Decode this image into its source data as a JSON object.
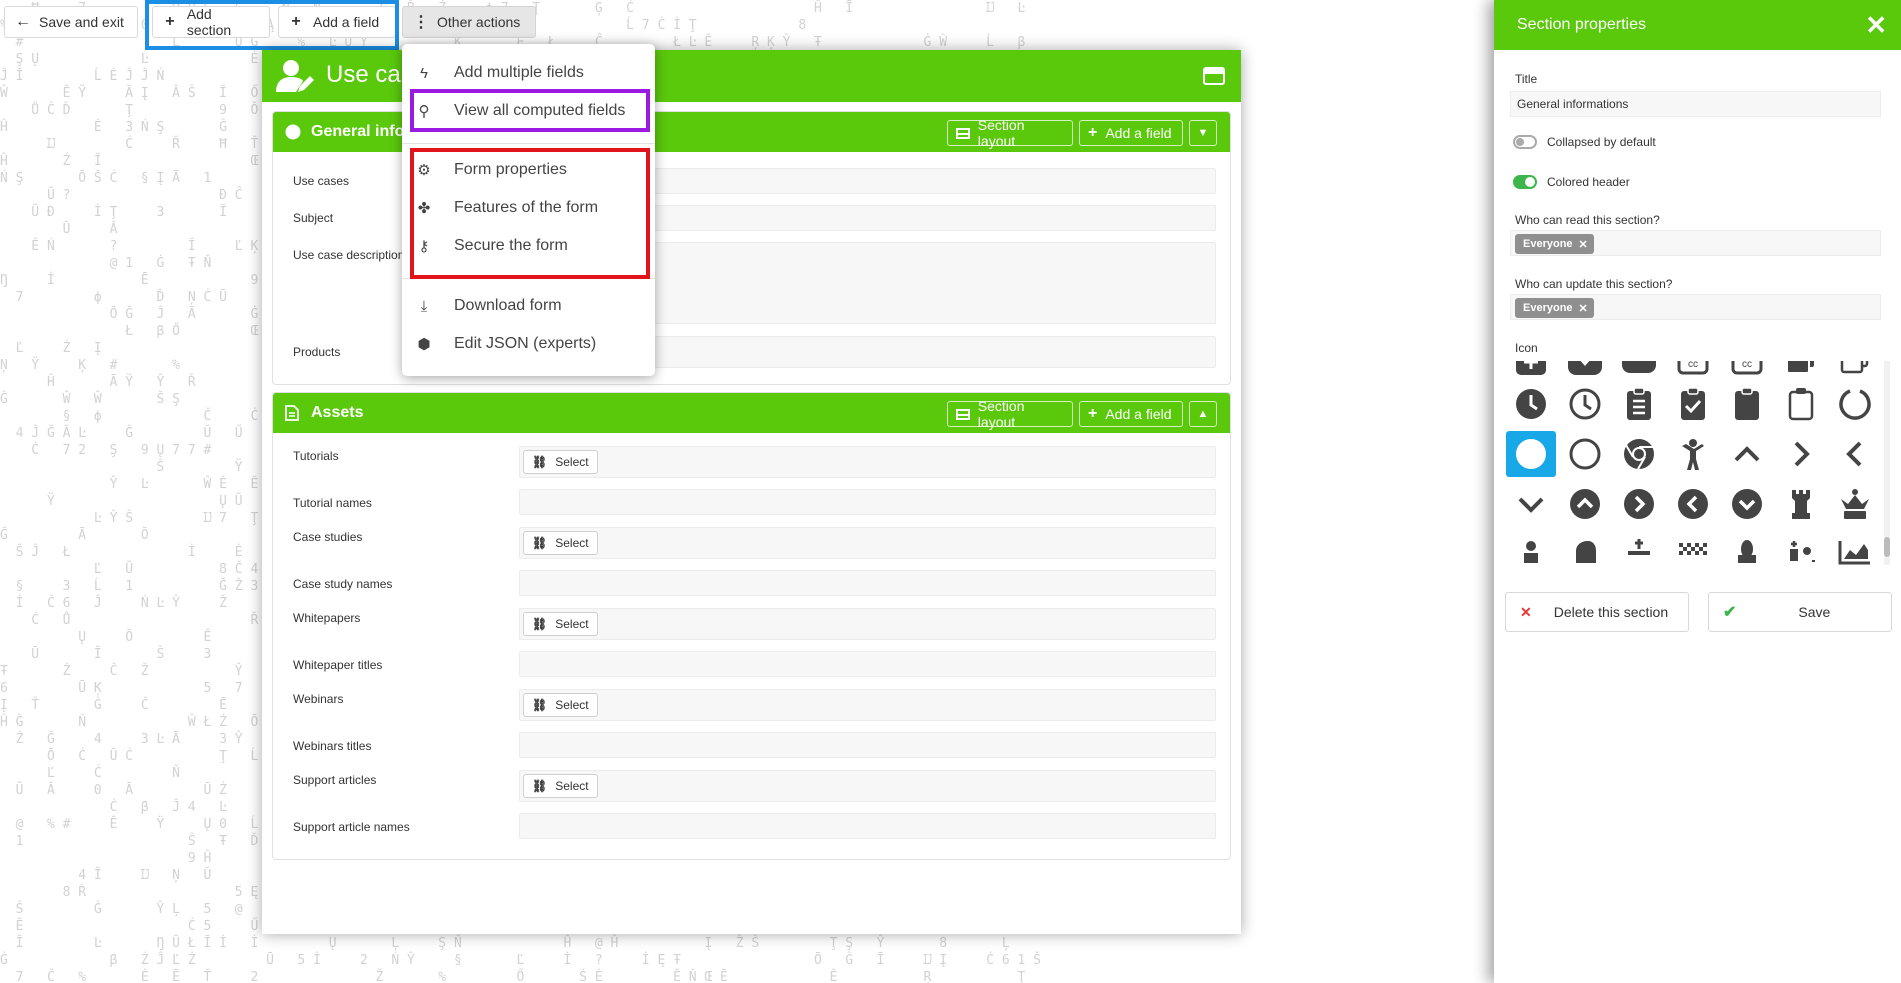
{
  "toolbar": {
    "save_exit_label": "Save and exit",
    "add_section_label": "Add section",
    "add_field_label": "Add a field",
    "other_actions_label": "Other actions"
  },
  "form": {
    "title": "Use ca"
  },
  "sections": [
    {
      "title": "General info",
      "layout_label": "Section layout",
      "add_field_label": "Add a field",
      "fields": [
        "Use cases",
        "Subject",
        "Use case description",
        "Products"
      ]
    },
    {
      "title": "Assets",
      "layout_label": "Section layout",
      "add_field_label": "Add a field",
      "select_label": "Select",
      "fields": [
        "Tutorials",
        "Tutorial names",
        "Case studies",
        "Case study names",
        "Whitepapers",
        "Whitepaper titles",
        "Webinars",
        "Webinars titles",
        "Support articles",
        "Support article names"
      ]
    }
  ],
  "menu": {
    "items": [
      {
        "label": "Add multiple fields",
        "icon": "bolt-icon"
      },
      {
        "label": "View all computed fields",
        "icon": "magnifier-icon"
      },
      {
        "label": "Form properties",
        "icon": "gear-icon"
      },
      {
        "label": "Features of the form",
        "icon": "puzzle-icon"
      },
      {
        "label": "Secure the form",
        "icon": "key-icon"
      },
      {
        "label": "Download form",
        "icon": "download-icon"
      },
      {
        "label": "Edit JSON (experts)",
        "icon": "code-icon"
      }
    ]
  },
  "panel": {
    "title": "Section properties",
    "title_label": "Title",
    "title_value": "General informations",
    "collapsed_label": "Collapsed by default",
    "collapsed_on": false,
    "colored_label": "Colored header",
    "colored_on": true,
    "read_label": "Who can read this section?",
    "read_tag": "Everyone",
    "update_label": "Who can update this section?",
    "update_tag": "Everyone",
    "icon_label": "Icon",
    "delete_label": "Delete this section",
    "save_label": "Save"
  },
  "colors": {
    "brand_green": "#5ac80b",
    "highlight_blue": "#1a8fe3",
    "highlight_purple": "#9b19e0",
    "highlight_red": "#e0141a",
    "selected_icon": "#18a8e8"
  }
}
